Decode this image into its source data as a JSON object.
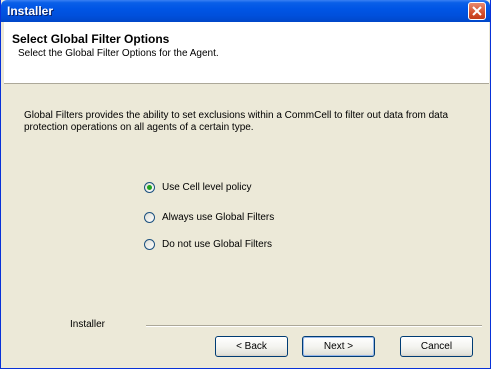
{
  "window": {
    "title": "Installer"
  },
  "header": {
    "title": "Select Global Filter Options",
    "subtitle": "Select the Global Filter Options for the Agent."
  },
  "main": {
    "description": "Global Filters provides the ability to set exclusions within a CommCell to filter out data from data protection operations on all agents of a certain type.",
    "options": [
      {
        "label": "Use Cell level policy",
        "selected": true
      },
      {
        "label": "Always use Global Filters",
        "selected": false
      },
      {
        "label": "Do not use Global Filters",
        "selected": false
      }
    ]
  },
  "footer": {
    "brand_label": "Installer",
    "back_label": "< Back",
    "next_label": "Next >",
    "cancel_label": "Cancel"
  },
  "colors": {
    "titlebar": "#0055e5",
    "dialog_bg": "#ece9d8",
    "radio_selected": "#21a121"
  }
}
